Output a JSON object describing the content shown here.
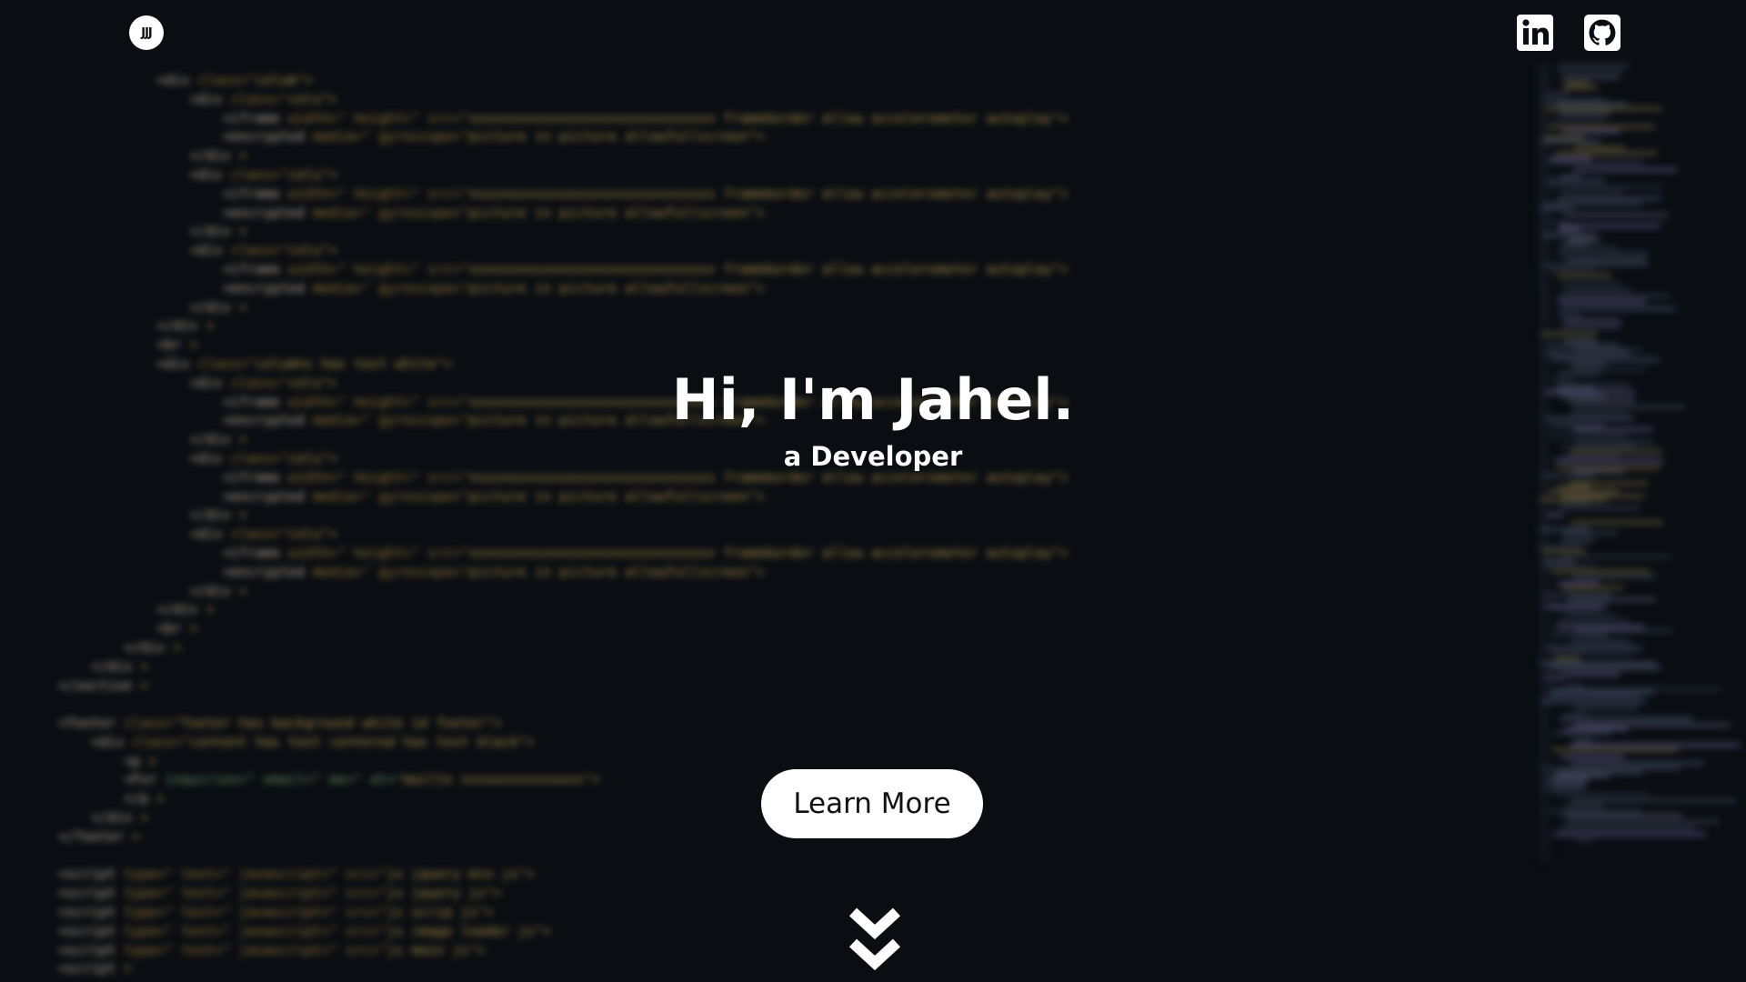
{
  "header": {
    "logo_text": "JJJ",
    "social": [
      {
        "name": "linkedin",
        "icon": "linkedin-icon",
        "label": "in"
      },
      {
        "name": "github",
        "icon": "github-icon"
      }
    ]
  },
  "hero": {
    "title": "Hi, I'm Jahel.",
    "subtitle": "a Developer",
    "cta_label": "Learn More",
    "scroll_icon": "chevrons-down-icon"
  },
  "colors": {
    "background": "#0a0d12",
    "text": "#ffffff",
    "button_bg": "#ffffff",
    "button_text": "#111111"
  }
}
